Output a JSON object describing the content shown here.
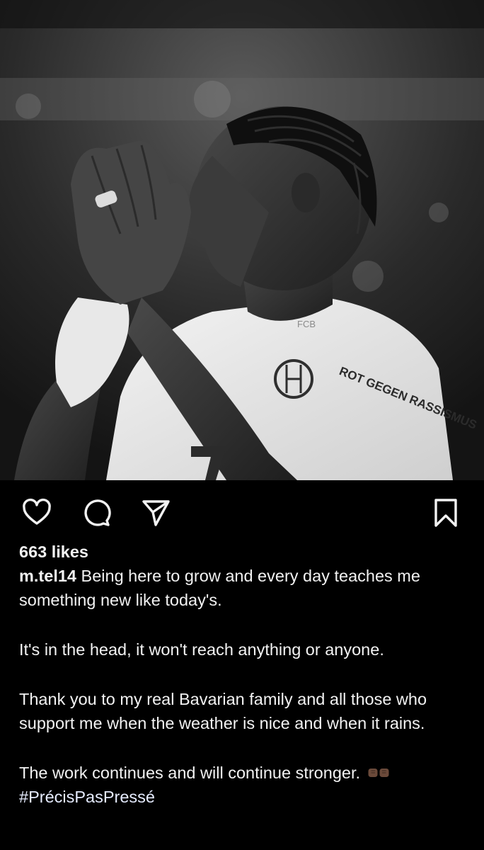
{
  "post": {
    "likes_text": "663 likes",
    "username": "m.tel14",
    "caption_first": " Being here to grow and every day teaches me something new like today's.",
    "paragraphs": [
      "It's in the head, it won't reach anything or anyone.",
      "Thank you to my real Bavarian family and all those who support me when the weather is nice and when it rains.",
      "The work continues and will continue stronger."
    ],
    "hashtag": "#PrécisPasPressé"
  },
  "photo": {
    "jersey_badge": "FCB",
    "sleeve_text": "ROT GEGEN RASSISMUS"
  },
  "icons": {
    "like": "heart-icon",
    "comment": "comment-icon",
    "share": "send-icon",
    "save": "bookmark-icon",
    "emoji": "fist-bump-emoji"
  }
}
